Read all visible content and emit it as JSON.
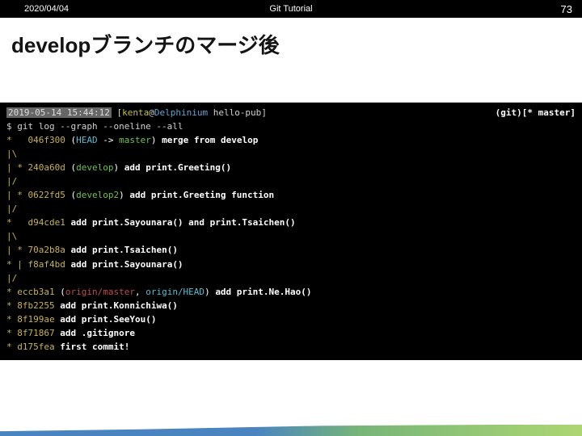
{
  "header": {
    "date": "2020/04/04",
    "title": "Git Tutorial",
    "page": "73"
  },
  "slide": {
    "title": "developブランチのマージ後"
  },
  "terminal": {
    "prompt_time": "2019-05-14 15:44:12",
    "prompt_user": "kenta",
    "prompt_at": "@",
    "prompt_host": "Delphinium",
    "prompt_dir": " hello-pub",
    "git_status": "(git)[* master]",
    "command": "$ git log --graph --oneline --all",
    "lines": [
      {
        "graph": "*   ",
        "hash": "046f300",
        "refs_open": " (",
        "head_kw": "HEAD",
        "arrow": " -> ",
        "branch": "master",
        "refs_close": ") ",
        "msg": "merge from develop"
      },
      {
        "graph": "|\\",
        "plain": ""
      },
      {
        "graph": "| * ",
        "hash": "240a60d",
        "refs_open": " (",
        "branch": "develop",
        "refs_close": ") ",
        "msg": "add print.Greeting()"
      },
      {
        "graph": "|/",
        "plain": ""
      },
      {
        "graph": "| * ",
        "hash": "0622fd5",
        "refs_open": " (",
        "branch": "develop2",
        "refs_close": ") ",
        "msg": "add print.Greeting function"
      },
      {
        "graph": "|/",
        "plain": ""
      },
      {
        "graph": "*   ",
        "hash": "d94cde1",
        "msg_pre": " ",
        "msg": "add print.Sayounara() and print.Tsaichen()"
      },
      {
        "graph": "|\\",
        "plain": ""
      },
      {
        "graph": "| * ",
        "hash": "70a2b8a",
        "msg_pre": " ",
        "msg": "add print.Tsaichen()"
      },
      {
        "graph": "* | ",
        "hash": "f8af4bd",
        "msg_pre": " ",
        "msg": "add print.Sayounara()"
      },
      {
        "graph": "|/",
        "plain": ""
      },
      {
        "graph": "* ",
        "hash": "eccb3a1",
        "refs_open": " (",
        "origin": "origin/master",
        "origin_sep": ", ",
        "origin_head": "origin/HEAD",
        "refs_close": ") ",
        "msg": "add print.Ne.Hao()"
      },
      {
        "graph": "* ",
        "hash": "8fb2255",
        "msg_pre": " ",
        "msg": "add print.Konnichiwa()"
      },
      {
        "graph": "* ",
        "hash": "8f199ae",
        "msg_pre": " ",
        "msg": "add print.SeeYou()"
      },
      {
        "graph": "* ",
        "hash": "8f71867",
        "msg_pre": " ",
        "msg": "add .gitignore"
      },
      {
        "graph": "* ",
        "hash": "d175fea",
        "msg_pre": " ",
        "msg": "first commit!"
      }
    ]
  }
}
